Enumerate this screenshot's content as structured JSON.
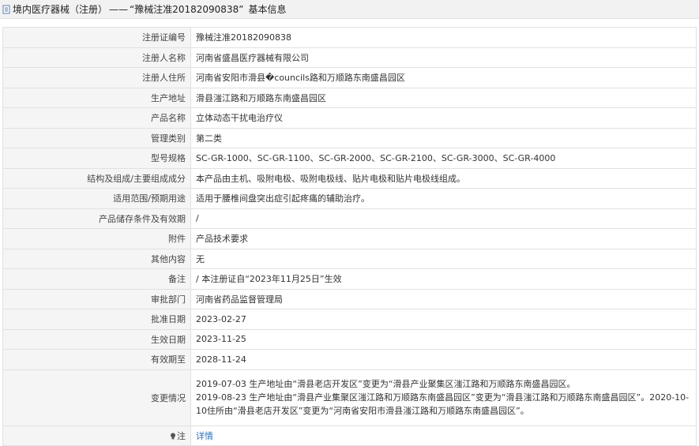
{
  "header": {
    "breadcrumb": "境内医疗器械（注册）",
    "separator": "——",
    "title": "“豫械注准20182090838”",
    "suffix": "基本信息"
  },
  "rows": [
    {
      "label": "注册证编号",
      "value": "豫械注准20182090838"
    },
    {
      "label": "注册人名称",
      "value": "河南省盛昌医疗器械有限公司"
    },
    {
      "label": "注册人住所",
      "value": "河南省安阳市滑县�councils路和万顺路东南盛昌园区"
    },
    {
      "label": "生产地址",
      "value": "滑县滍江路和万顺路东南盛昌园区"
    },
    {
      "label": "产品名称",
      "value": "立体动态干扰电治疗仪"
    },
    {
      "label": "管理类别",
      "value": "第二类"
    },
    {
      "label": "型号规格",
      "value": "SC-GR-1000、SC-GR-1100、SC-GR-2000、SC-GR-2100、SC-GR-3000、SC-GR-4000"
    },
    {
      "label": "结构及组成/主要组成成分",
      "value": "本产品由主机、吸附电极、吸附电极线、贴片电极和贴片电极线组成。"
    },
    {
      "label": "适用范围/预期用途",
      "value": "适用于腰椎间盘突出症引起疼痛的辅助治疗。"
    },
    {
      "label": "产品储存条件及有效期",
      "value": "/"
    },
    {
      "label": "附件",
      "value": "产品技术要求"
    },
    {
      "label": "其他内容",
      "value": "无"
    },
    {
      "label": "备注",
      "value": "/ 本注册证自“2023年11月25日”生效"
    },
    {
      "label": "审批部门",
      "value": "河南省药品监督管理局"
    },
    {
      "label": "批准日期",
      "value": "2023-02-27"
    },
    {
      "label": "生效日期",
      "value": "2023-11-25"
    },
    {
      "label": "有效期至",
      "value": "2028-11-24"
    }
  ],
  "change": {
    "label": "变更情况",
    "line1": "2019-07-03 生产地址由“滑县老店开发区”变更为“滑县产业聚集区滍江路和万顺路东南盛昌园区。",
    "line2": "2019-08-23 生产地址由“滑县产业集聚区滍江路和万顺路东南盛昌园区”变更为“滑县滍江路和万顺路东南盛昌园区”。2020-10-10住所由“滑县老店开发区”变更为“河南省安阳市滑县滍江路和万顺路东南盛昌园区”。"
  },
  "note": {
    "label": "注",
    "icon": "bulb-icon",
    "link": "详情"
  },
  "colors": {
    "link": "#2a6fbf",
    "label_bg": "#f5f5f5",
    "border": "#e1e1e1"
  }
}
